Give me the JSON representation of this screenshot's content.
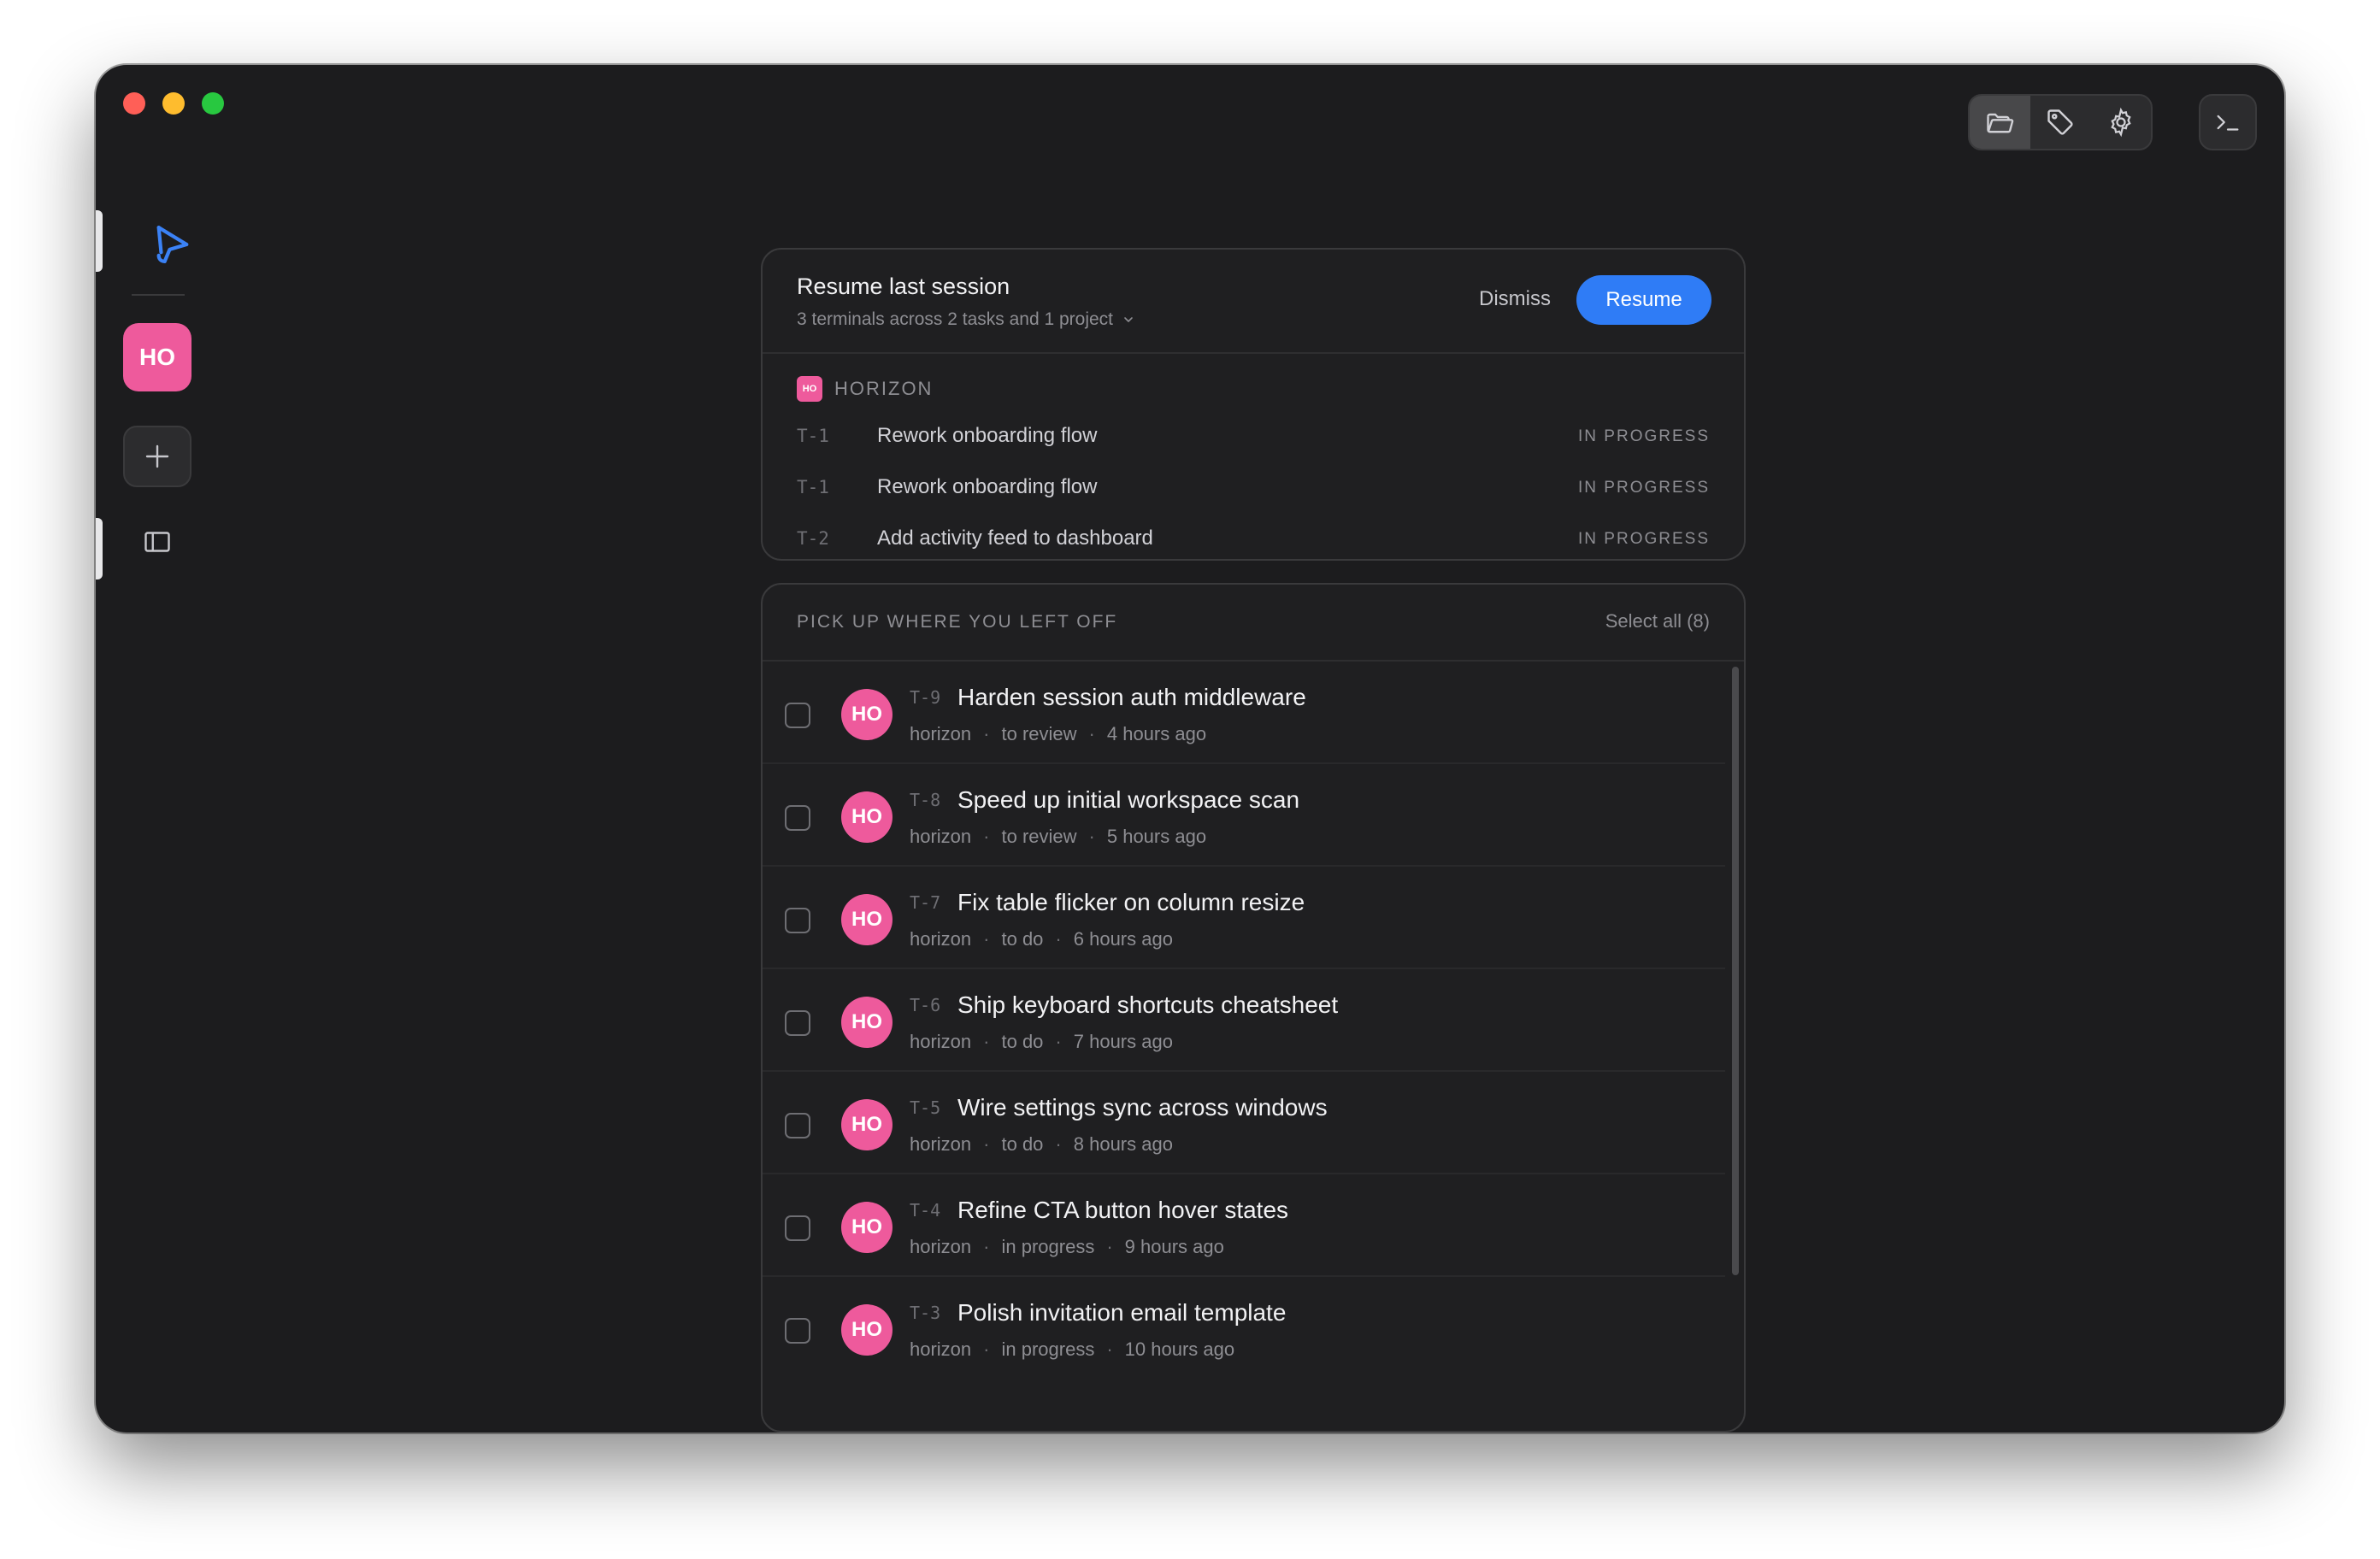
{
  "colors": {
    "accent": "#2f7cf6",
    "project": "#ee5a9c",
    "window_bg": "#1c1c1e",
    "card_bg": "#1f1f21"
  },
  "toolbar": {
    "icons": [
      "folder-icon",
      "tag-icon",
      "gear-icon"
    ],
    "terminal_icon": "terminal-icon"
  },
  "rail": {
    "logo_icon": "app-logo-icon",
    "project_badge": "HO",
    "add_icon": "plus-icon",
    "sidebar_icon": "sidebar-icon"
  },
  "resume": {
    "title": "Resume last session",
    "subtitle": "3 terminals across 2 tasks and 1 project",
    "dismiss_label": "Dismiss",
    "resume_label": "Resume",
    "project": {
      "badge": "HO",
      "name": "HORIZON"
    },
    "terminals": [
      {
        "id": "T-1",
        "title": "Rework onboarding flow",
        "status": "IN PROGRESS"
      },
      {
        "id": "T-1",
        "title": "Rework onboarding flow",
        "status": "IN PROGRESS"
      },
      {
        "id": "T-2",
        "title": "Add activity feed to dashboard",
        "status": "IN PROGRESS"
      }
    ]
  },
  "pickup": {
    "heading": "PICK UP WHERE YOU LEFT OFF",
    "select_all": "Select all (8)",
    "tasks": [
      {
        "avatar": "HO",
        "id": "T-9",
        "title": "Harden session auth middleware",
        "project": "horizon",
        "state": "to review",
        "time": "4 hours ago"
      },
      {
        "avatar": "HO",
        "id": "T-8",
        "title": "Speed up initial workspace scan",
        "project": "horizon",
        "state": "to review",
        "time": "5 hours ago"
      },
      {
        "avatar": "HO",
        "id": "T-7",
        "title": "Fix table flicker on column resize",
        "project": "horizon",
        "state": "to do",
        "time": "6 hours ago"
      },
      {
        "avatar": "HO",
        "id": "T-6",
        "title": "Ship keyboard shortcuts cheatsheet",
        "project": "horizon",
        "state": "to do",
        "time": "7 hours ago"
      },
      {
        "avatar": "HO",
        "id": "T-5",
        "title": "Wire settings sync across windows",
        "project": "horizon",
        "state": "to do",
        "time": "8 hours ago"
      },
      {
        "avatar": "HO",
        "id": "T-4",
        "title": "Refine CTA button hover states",
        "project": "horizon",
        "state": "in progress",
        "time": "9 hours ago"
      },
      {
        "avatar": "HO",
        "id": "T-3",
        "title": "Polish invitation email template",
        "project": "horizon",
        "state": "in progress",
        "time": "10 hours ago"
      }
    ]
  }
}
